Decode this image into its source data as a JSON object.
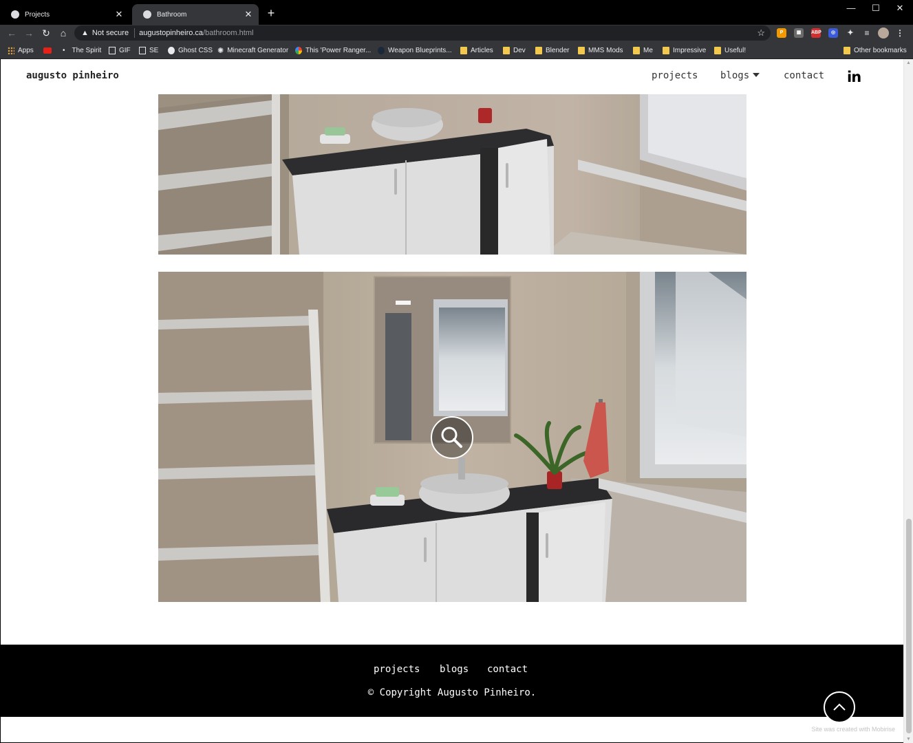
{
  "browser": {
    "tabs": [
      {
        "title": "Projects",
        "close": "✕"
      },
      {
        "title": "Bathroom",
        "close": "✕"
      }
    ],
    "new_tab": "+",
    "window_controls": {
      "minimize": "—",
      "maximize": "☐",
      "close": "✕"
    },
    "nav": {
      "back": "←",
      "forward": "→",
      "reload": "↻",
      "home": "⌂"
    },
    "address": {
      "security_label": "Not secure",
      "host": "augustopinheiro.ca",
      "path": "/bathroom.html"
    },
    "bookmarks": [
      {
        "label": "Apps",
        "icon": "apps-grid-icon"
      },
      {
        "label": "",
        "icon": "youtube-icon"
      },
      {
        "label": "The Spirit",
        "icon": "dot-icon"
      },
      {
        "label": "GIF",
        "icon": "page-icon"
      },
      {
        "label": "SE",
        "icon": "stack-exchange-icon"
      },
      {
        "label": "Ghost CSS",
        "icon": "ghost-icon"
      },
      {
        "label": "Minecraft Generator",
        "icon": "gear-icon"
      },
      {
        "label": "This 'Power Ranger...",
        "icon": "globe-icon"
      },
      {
        "label": "Weapon Blueprints...",
        "icon": "site-icon"
      },
      {
        "label": "Articles",
        "icon": "folder-icon"
      },
      {
        "label": "Dev",
        "icon": "folder-icon"
      },
      {
        "label": "Blender",
        "icon": "folder-icon"
      },
      {
        "label": "MMS Mods",
        "icon": "folder-icon"
      },
      {
        "label": "Me",
        "icon": "folder-icon"
      },
      {
        "label": "Impressive",
        "icon": "folder-icon"
      },
      {
        "label": "Useful!",
        "icon": "folder-icon"
      }
    ],
    "other_bookmarks": "Other bookmarks",
    "extensions": [
      {
        "name": "extension-orange-icon",
        "text": "P",
        "color": "#f29900"
      },
      {
        "name": "extension-gray-icon",
        "text": "▦",
        "color": "#6b6b6b"
      },
      {
        "name": "adblock-icon",
        "text": "ABP",
        "color": "#d32f2f"
      },
      {
        "name": "extension-blue-icon",
        "text": "◎",
        "color": "#3b5bdb"
      },
      {
        "name": "puzzle-icon",
        "text": "✦",
        "color": "#35363a"
      },
      {
        "name": "media-icon",
        "text": "≡",
        "color": "#35363a"
      }
    ]
  },
  "site": {
    "brand": "augusto pinheiro",
    "nav": {
      "projects": "projects",
      "blogs": "blogs",
      "contact": "contact",
      "linkedin": "in"
    },
    "footer": {
      "projects": "projects",
      "blogs": "blogs",
      "contact": "contact",
      "copyright": "© Copyright Augusto Pinheiro."
    },
    "credit": "Site was created with Mobirise"
  },
  "colors": {
    "footer_bg": "#000000",
    "chrome_bg": "#35363a",
    "tabstrip_bg": "#000000"
  }
}
